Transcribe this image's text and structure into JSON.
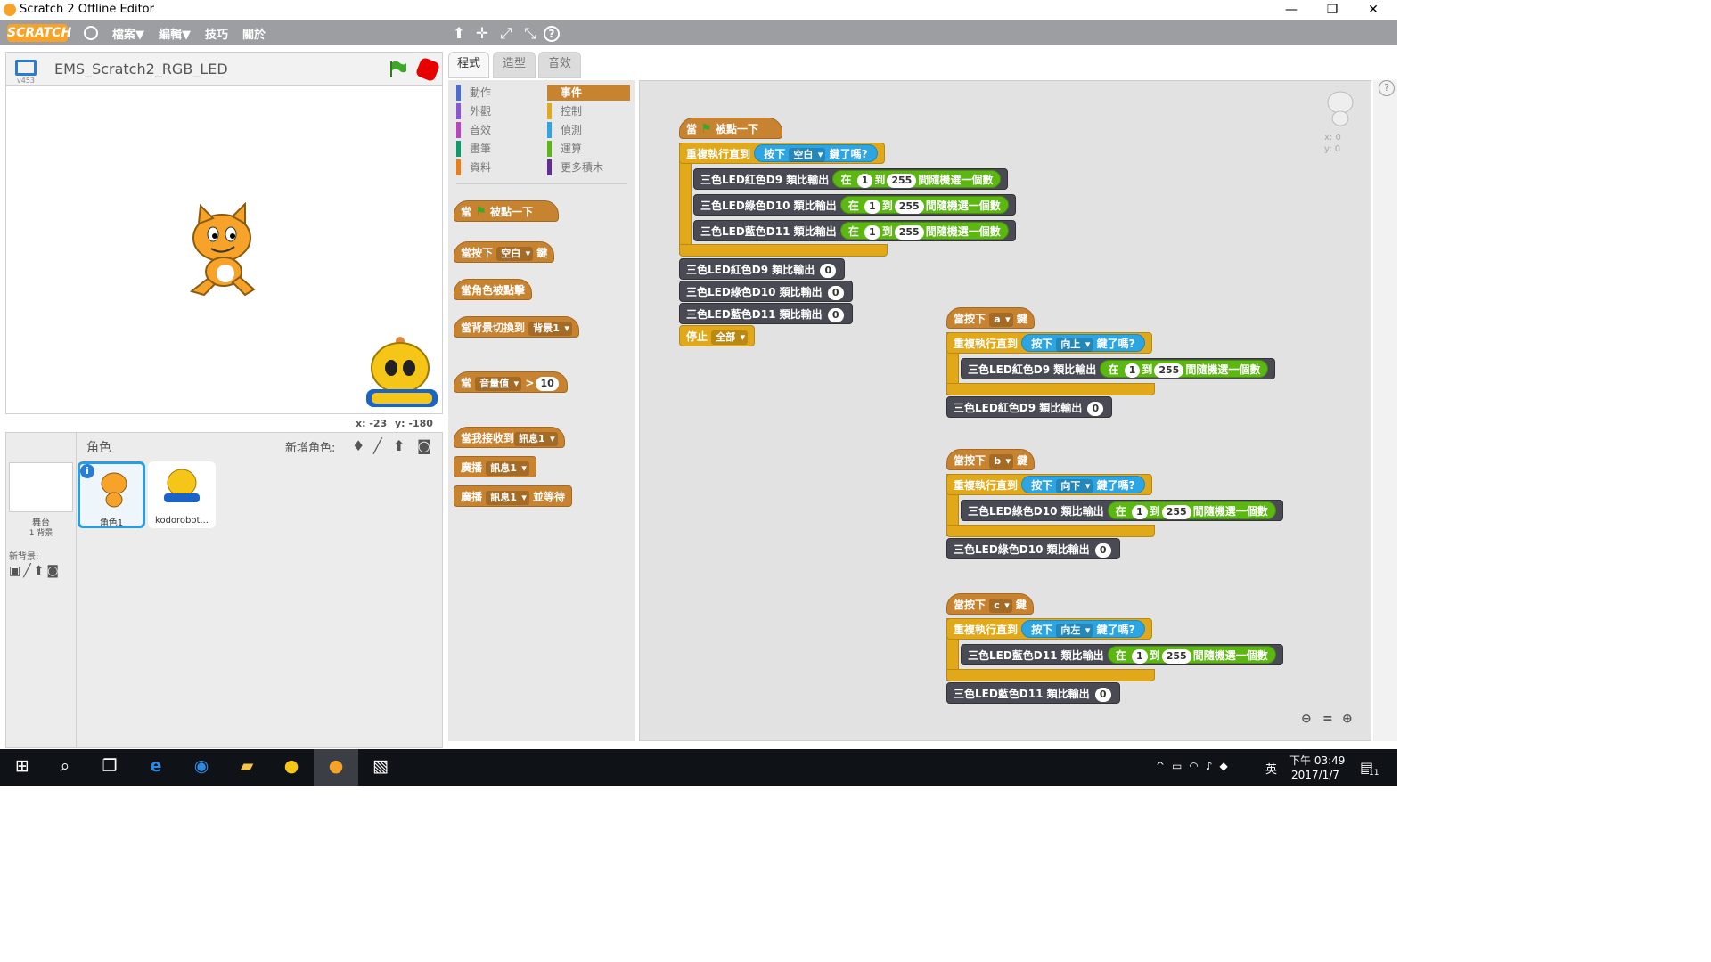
{
  "window": {
    "title": "Scratch 2 Offline Editor",
    "minimize": "—",
    "restore": "❐",
    "close": "✕"
  },
  "menubar": {
    "logo": "SCRATCH",
    "items": [
      "檔案▼",
      "編輯▼",
      "技巧",
      "關於"
    ],
    "tools": [
      "⬆",
      "✛",
      "⤢",
      "⤡",
      "?"
    ]
  },
  "stage": {
    "project_name": "EMS_Scratch2_RGB_LED",
    "version": "v453",
    "coords_x": "x: -23",
    "coords_y": "y: -180"
  },
  "sprites": {
    "header": "角色",
    "new_sprite": "新增角色:",
    "stage_label": "舞台",
    "stage_sub": "1 背景",
    "new_backdrop": "新背景:",
    "items": [
      {
        "name": "角色1"
      },
      {
        "name": "kodorobot..."
      }
    ]
  },
  "tabs": [
    "程式",
    "造型",
    "音效"
  ],
  "categories": {
    "left": [
      "動作",
      "外觀",
      "音效",
      "畫筆",
      "資料"
    ],
    "right": [
      "事件",
      "控制",
      "偵測",
      "運算",
      "更多積木"
    ],
    "active": "事件"
  },
  "palette": {
    "when_flag": "當",
    "when_flag_suffix": "被點一下",
    "when_key_pre": "當按下",
    "when_key_val": "空白",
    "when_key_post": "鍵",
    "when_clicked": "當角色被點擊",
    "when_backdrop": "當背景切換到",
    "backdrop_val": "背景1",
    "when_gt": "當",
    "loudness": "音量值",
    "gt": ">",
    "gt_val": "10",
    "when_receive": "當我接收到",
    "msg_val": "訊息1",
    "broadcast": "廣播",
    "broadcast_wait": "並等待"
  },
  "script1": {
    "hat_pre": "當",
    "hat_post": "被點一下",
    "repeat": "重複執行直到",
    "sense_pre": "按下",
    "sense_key": "空白",
    "sense_post": "鍵了嗎?",
    "led_red": "三色LED紅色D9 類比輸出",
    "led_green": "三色LED綠色D10 類比輸出",
    "led_blue": "三色LED藍色D11 類比輸出",
    "rand_pre": "在",
    "rand_from": "1",
    "rand_to_word": "到",
    "rand_to": "255",
    "rand_post": "間隨機選一個數",
    "zero": "0",
    "stop": "停止",
    "stop_val": "全部"
  },
  "script_a": {
    "key_pre": "當按下",
    "key": "a",
    "key_post": "鍵",
    "repeat": "重複執行直到",
    "sense_pre": "按下",
    "sense_key": "向上",
    "sense_post": "鍵了嗎?",
    "led": "三色LED紅色D9 類比輸出",
    "zero": "0"
  },
  "script_b": {
    "key_pre": "當按下",
    "key": "b",
    "key_post": "鍵",
    "repeat": "重複執行直到",
    "sense_pre": "按下",
    "sense_key": "向下",
    "sense_post": "鍵了嗎?",
    "led": "三色LED綠色D10 類比輸出",
    "zero": "0"
  },
  "script_c": {
    "key_pre": "當按下",
    "key": "c",
    "key_post": "鍵",
    "repeat": "重複執行直到",
    "sense_pre": "按下",
    "sense_key": "向左",
    "sense_post": "鍵了嗎?",
    "led": "三色LED藍色D11 類比輸出",
    "zero": "0"
  },
  "scripts_area": {
    "sprite_x": "x: 0",
    "sprite_y": "y: 0",
    "zoom_out": "🔍−",
    "zoom_reset": "=",
    "zoom_in": "🔍+"
  },
  "taskbar": {
    "time": "下午 03:49",
    "date": "2017/1/7",
    "ime": "英",
    "notif": "11"
  },
  "colors": {
    "events": "#c88330",
    "control": "#e1a91a",
    "sensing": "#2ca5e2",
    "operators": "#5cb712",
    "more": "#4a4a55",
    "menubar": "#9c9ea2"
  }
}
